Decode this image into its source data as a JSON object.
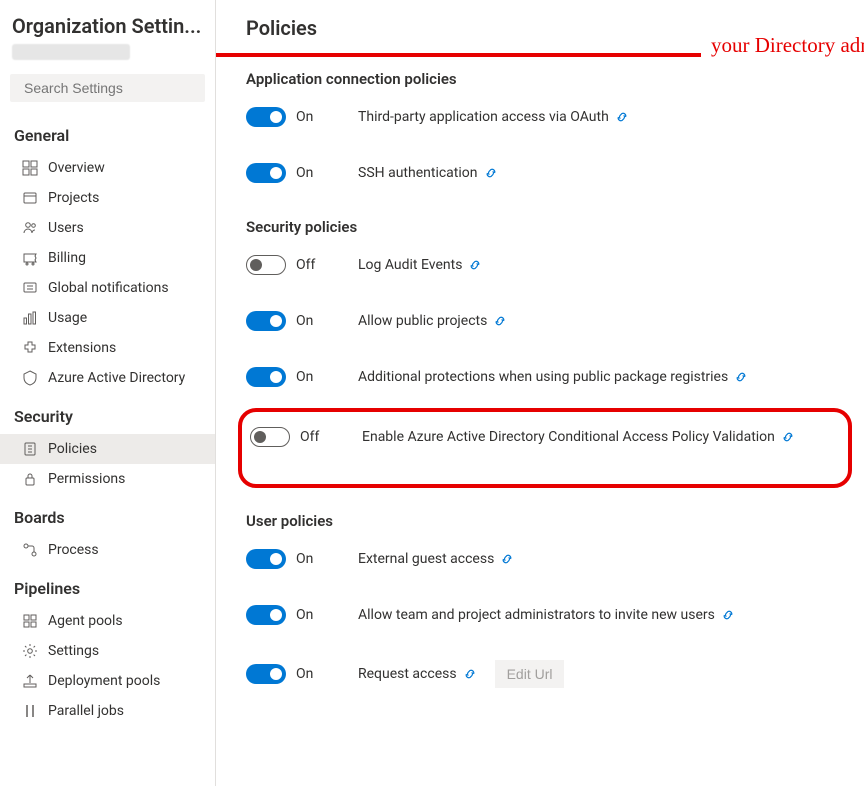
{
  "sidebar": {
    "title": "Organization Settin...",
    "search_placeholder": "Search Settings",
    "sections": [
      {
        "label": "General",
        "items": [
          {
            "label": "Overview",
            "icon": "overview"
          },
          {
            "label": "Projects",
            "icon": "projects"
          },
          {
            "label": "Users",
            "icon": "users"
          },
          {
            "label": "Billing",
            "icon": "billing"
          },
          {
            "label": "Global notifications",
            "icon": "notifications"
          },
          {
            "label": "Usage",
            "icon": "usage"
          },
          {
            "label": "Extensions",
            "icon": "extensions"
          },
          {
            "label": "Azure Active Directory",
            "icon": "aad"
          }
        ]
      },
      {
        "label": "Security",
        "items": [
          {
            "label": "Policies",
            "icon": "policies",
            "active": true
          },
          {
            "label": "Permissions",
            "icon": "permissions"
          }
        ]
      },
      {
        "label": "Boards",
        "items": [
          {
            "label": "Process",
            "icon": "process"
          }
        ]
      },
      {
        "label": "Pipelines",
        "items": [
          {
            "label": "Agent pools",
            "icon": "agentpools"
          },
          {
            "label": "Settings",
            "icon": "settings"
          },
          {
            "label": "Deployment pools",
            "icon": "deployment"
          },
          {
            "label": "Parallel jobs",
            "icon": "parallel"
          }
        ]
      }
    ]
  },
  "main": {
    "title": "Policies",
    "groups": [
      {
        "title": "Application connection policies",
        "rows": [
          {
            "on": true,
            "state": "On",
            "desc": "Third-party application access via OAuth"
          },
          {
            "on": true,
            "state": "On",
            "desc": "SSH authentication"
          }
        ]
      },
      {
        "title": "Security policies",
        "rows": [
          {
            "on": false,
            "state": "Off",
            "desc": "Log Audit Events"
          },
          {
            "on": true,
            "state": "On",
            "desc": "Allow public projects"
          },
          {
            "on": true,
            "state": "On",
            "desc": "Additional protections when using public package registries"
          },
          {
            "on": false,
            "state": "Off",
            "desc": "Enable Azure Active Directory Conditional Access Policy Validation",
            "highlight": true
          }
        ]
      },
      {
        "title": "User policies",
        "rows": [
          {
            "on": true,
            "state": "On",
            "desc": "External guest access"
          },
          {
            "on": true,
            "state": "On",
            "desc": "Allow team and project administrators to invite new users"
          },
          {
            "on": true,
            "state": "On",
            "desc": "Request access",
            "button": "Edit Url"
          }
        ]
      }
    ]
  },
  "annotation": {
    "text": "your Directory administrator"
  }
}
